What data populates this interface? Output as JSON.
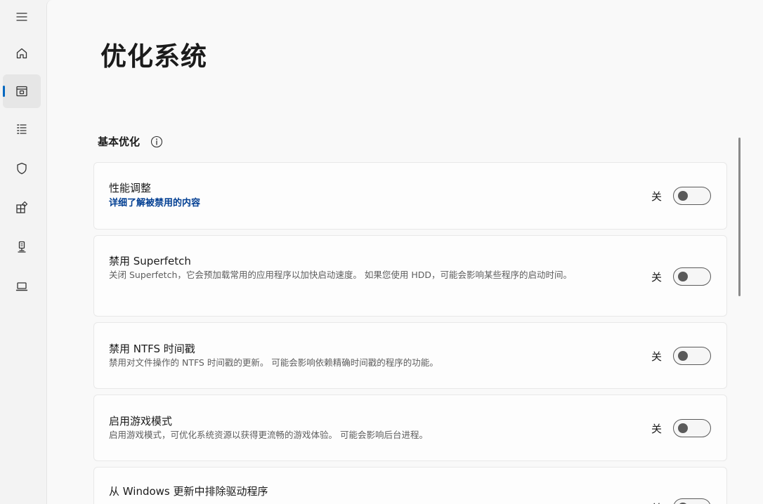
{
  "page": {
    "title": "优化系统"
  },
  "section": {
    "title": "基本优化"
  },
  "nav": {
    "items": [
      {
        "icon": "menu-icon"
      },
      {
        "icon": "home-icon"
      },
      {
        "icon": "optimize-icon",
        "selected": true
      },
      {
        "icon": "list-icon"
      },
      {
        "icon": "shield-icon"
      },
      {
        "icon": "apps-icon"
      },
      {
        "icon": "cleaner-icon"
      },
      {
        "icon": "laptop-icon"
      }
    ]
  },
  "cards": [
    {
      "title": "性能调整",
      "link": "详细了解被禁用的内容",
      "state": "关",
      "on": false
    },
    {
      "title": "禁用 Superfetch",
      "desc": "关闭 Superfetch，它会预加载常用的应用程序以加快启动速度。 如果您使用 HDD，可能会影响某些程序的启动时间。",
      "state": "关",
      "on": false
    },
    {
      "title": "禁用 NTFS 时间戳",
      "desc": "禁用对文件操作的 NTFS 时间戳的更新。 可能会影响依赖精确时间戳的程序的功能。",
      "state": "关",
      "on": false
    },
    {
      "title": "启用游戏模式",
      "desc": "启用游戏模式，可优化系统资源以获得更流畅的游戏体验。 可能会影响后台进程。",
      "state": "关",
      "on": false
    },
    {
      "title": "从 Windows 更新中排除驱动程序",
      "state": "关",
      "on": false
    }
  ],
  "colors": {
    "accent": "#0067c0",
    "link": "#003e92",
    "background": "#f9f9f9",
    "card": "#fdfdfd"
  }
}
